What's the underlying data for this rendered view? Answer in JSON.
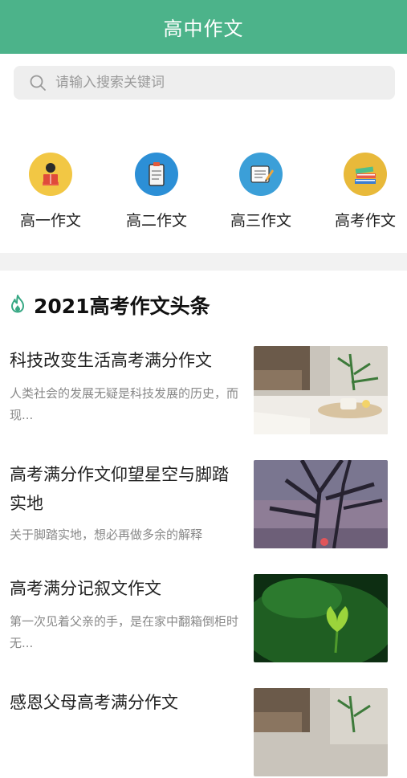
{
  "header": {
    "title": "高中作文"
  },
  "search": {
    "placeholder": "请输入搜索关键词"
  },
  "categories": [
    {
      "label": "高一作文",
      "icon": "reading-person-icon"
    },
    {
      "label": "高二作文",
      "icon": "clipboard-icon"
    },
    {
      "label": "高三作文",
      "icon": "notepad-pen-icon"
    },
    {
      "label": "高考作文",
      "icon": "stacked-books-icon"
    }
  ],
  "section": {
    "title": "2021高考作文头条",
    "icon": "flame-icon"
  },
  "articles": [
    {
      "title": "科技改变生活高考满分作文",
      "summary": "人类社会的发展无疑是科技发展的历史，而现...",
      "thumb": "desk-coffee-book-image"
    },
    {
      "title": "高考满分作文仰望星空与脚踏实地",
      "summary": "关于脚踏实地，想必再做多余的解释",
      "thumb": "tree-silhouette-sunset-image"
    },
    {
      "title": "高考满分记叙文作文",
      "summary": "第一次见着父亲的手，是在家中翻箱倒柜时无...",
      "thumb": "lotus-leaf-bud-image"
    },
    {
      "title": "感恩父母高考满分作文",
      "summary": "",
      "thumb": "desk-coffee-book-image"
    }
  ],
  "colors": {
    "header": "#4cb38a",
    "accent_green": "#37a884",
    "divider": "#f2f2f2"
  }
}
